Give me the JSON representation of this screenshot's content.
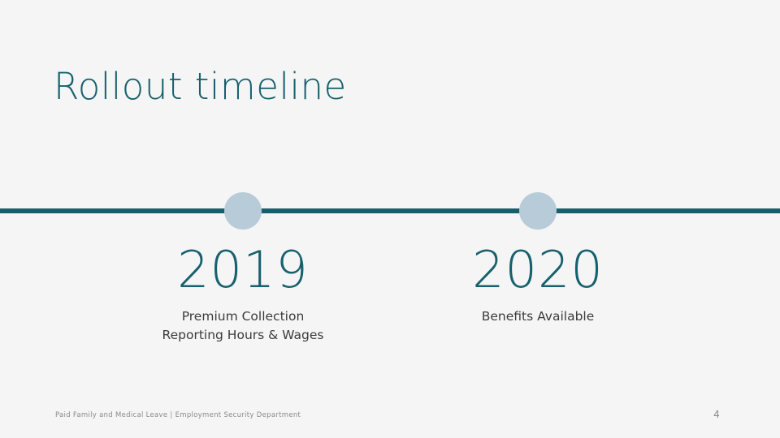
{
  "slide": {
    "title": "Rollout timeline",
    "background_color": "#f4f5f4",
    "accent_color": "#16606d",
    "marker_color": "#b7cbd8",
    "caption_color": "#3b3b3b"
  },
  "timeline": {
    "milestones": [
      {
        "year": "2019",
        "caption": "Premium Collection\nReporting Hours & Wages"
      },
      {
        "year": "2020",
        "caption": "Benefits Available"
      }
    ]
  },
  "footer": {
    "text": "Paid Family and Medical Leave | Employment Security Department",
    "page_number": "4"
  }
}
